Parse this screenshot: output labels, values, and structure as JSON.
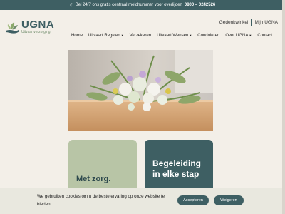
{
  "topbar": {
    "icon": "phone-icon",
    "text": "Bel 24/7 ons gratis centraal meldnummer voor overlijden",
    "number": "0800 – 0242526"
  },
  "brand": {
    "name": "UGNA",
    "tagline": "Uitvaartverzorging"
  },
  "utility_links": [
    "Gedenkwinkel",
    "Mijn UGNA"
  ],
  "nav": {
    "items": [
      {
        "label": "Home",
        "dropdown": false
      },
      {
        "label": "Uitvaart Regelen",
        "dropdown": true
      },
      {
        "label": "Verzekeren",
        "dropdown": false
      },
      {
        "label": "Uitvaart Wensen",
        "dropdown": true
      },
      {
        "label": "Condoleren",
        "dropdown": false
      },
      {
        "label": "Over UGNA",
        "dropdown": true
      },
      {
        "label": "Contact",
        "dropdown": false
      }
    ]
  },
  "cards": {
    "left": "Met zorg.",
    "right_line1": "Begeleiding",
    "right_line2": "in elke stap"
  },
  "cookie": {
    "message": "We gebruiken cookies om u de beste ervaring op onze website te bieden.",
    "accept": "Accepteren",
    "reject": "Weigeren"
  },
  "colors": {
    "primary": "#3e5f63",
    "sage": "#b8c5a6",
    "background": "#f3efe8"
  }
}
